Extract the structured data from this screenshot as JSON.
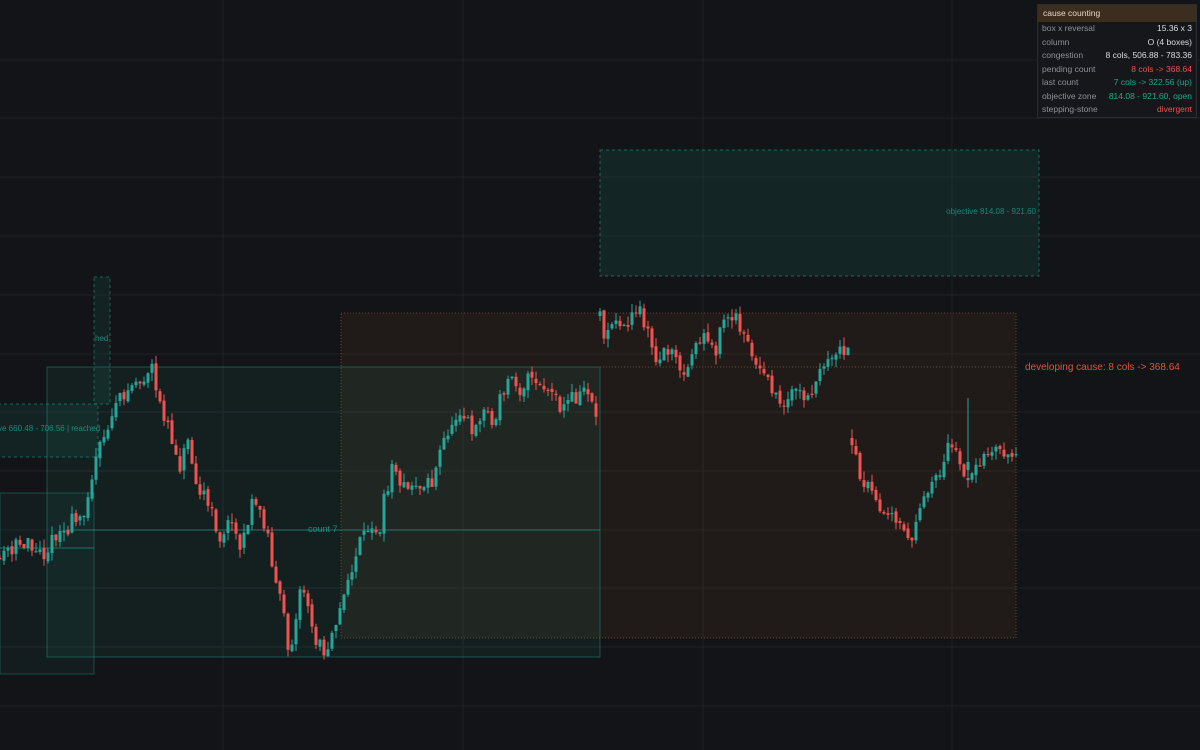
{
  "colors": {
    "background": "#131417",
    "grid": "#1f2126",
    "up": "#26a69a",
    "down": "#ef5350",
    "box_teal": "#1f9c8a",
    "box_orange": "#a9692c",
    "label_red": "#e0533b"
  },
  "panel": {
    "title": "cause counting",
    "rows": [
      {
        "key": "box x reversal",
        "value": "15.36 x 3",
        "tone": "neutral"
      },
      {
        "key": "column",
        "value": "O (4 boxes)",
        "tone": "neutral"
      },
      {
        "key": "congestion",
        "value": "8 cols, 506.88 - 783.36",
        "tone": "neutral"
      },
      {
        "key": "pending count",
        "value": "8 cols -> 368.64",
        "tone": "red"
      },
      {
        "key": "last count",
        "value": "7 cols -> 322.56 (up)",
        "tone": "green"
      },
      {
        "key": "objective zone",
        "value": "814.08 - 921.60, open",
        "tone": "green"
      },
      {
        "key": "stepping-stone",
        "value": "divergent",
        "tone": "red"
      }
    ]
  },
  "annotations": {
    "objective_label": "objective 814.08 - 921.60",
    "count_label": "count 7",
    "developing_label": "developing cause: 8 cols -> 368.64",
    "left_zone_label": "ve 660.48 - 706.56 | reached",
    "left_small_label": "hed"
  },
  "chart_data": {
    "type": "candlestick",
    "ylim": [
      280,
      1040
    ],
    "grid": true,
    "zones": [
      {
        "name": "objective zone",
        "price_low": 814.08,
        "price_high": 921.6
      },
      {
        "name": "congestion",
        "price_low": 506.88,
        "price_high": 783.36
      },
      {
        "name": "developing cause",
        "target": 368.64
      },
      {
        "name": "last count",
        "target": 322.56
      },
      {
        "name": "reached objective",
        "price_low": 660.48,
        "price_high": 706.56
      }
    ],
    "segments": [
      {
        "anchors": [
          [
            0,
            560
          ],
          [
            6,
            548
          ],
          [
            12,
            556
          ],
          [
            18,
            540
          ],
          [
            22,
            548
          ],
          [
            28,
            535
          ],
          [
            34,
            558
          ],
          [
            40,
            545
          ],
          [
            44,
            555
          ],
          [
            50,
            545
          ],
          [
            56,
            535
          ],
          [
            62,
            528
          ],
          [
            66,
            535
          ],
          [
            72,
            520
          ],
          [
            78,
            522
          ],
          [
            84,
            510
          ],
          [
            90,
            485
          ],
          [
            94,
            470
          ],
          [
            98,
            450
          ],
          [
            104,
            440
          ],
          [
            108,
            430
          ],
          [
            112,
            412
          ],
          [
            118,
            402
          ],
          [
            124,
            395
          ],
          [
            130,
            388
          ],
          [
            136,
            380
          ],
          [
            142,
            385
          ],
          [
            148,
            375
          ],
          [
            152,
            368
          ],
          [
            156,
            395
          ],
          [
            160,
            405
          ],
          [
            164,
            415
          ],
          [
            168,
            422
          ],
          [
            172,
            440
          ],
          [
            176,
            455
          ],
          [
            180,
            465
          ],
          [
            184,
            450
          ],
          [
            188,
            440
          ],
          [
            194,
            465
          ],
          [
            198,
            490
          ],
          [
            204,
            495
          ],
          [
            210,
            510
          ],
          [
            214,
            520
          ],
          [
            218,
            535
          ],
          [
            222,
            540
          ],
          [
            226,
            532
          ],
          [
            230,
            520
          ],
          [
            236,
            528
          ],
          [
            240,
            545
          ],
          [
            246,
            530
          ],
          [
            250,
            512
          ],
          [
            254,
            500
          ],
          [
            258,
            510
          ],
          [
            262,
            520
          ],
          [
            266,
            525
          ],
          [
            270,
            548
          ],
          [
            274,
            572
          ],
          [
            278,
            590
          ],
          [
            282,
            608
          ],
          [
            286,
            632
          ],
          [
            290,
            655
          ],
          [
            294,
            625
          ],
          [
            298,
            600
          ],
          [
            302,
            585
          ],
          [
            306,
            598
          ],
          [
            310,
            620
          ],
          [
            314,
            634
          ],
          [
            318,
            648
          ],
          [
            322,
            642
          ],
          [
            326,
            660
          ],
          [
            330,
            632
          ],
          [
            334,
            622
          ],
          [
            338,
            618
          ],
          [
            342,
            600
          ],
          [
            346,
            592
          ],
          [
            350,
            580
          ],
          [
            354,
            560
          ],
          [
            358,
            545
          ],
          [
            362,
            538
          ],
          [
            366,
            535
          ],
          [
            372,
            532
          ],
          [
            376,
            528
          ],
          [
            380,
            530
          ],
          [
            384,
            500
          ],
          [
            388,
            485
          ],
          [
            392,
            470
          ],
          [
            396,
            465
          ],
          [
            400,
            480
          ],
          [
            404,
            488
          ],
          [
            408,
            490
          ],
          [
            412,
            485
          ],
          [
            416,
            482
          ],
          [
            420,
            492
          ],
          [
            424,
            485
          ],
          [
            428,
            480
          ],
          [
            432,
            482
          ],
          [
            436,
            470
          ],
          [
            440,
            455
          ],
          [
            444,
            440
          ],
          [
            448,
            432
          ],
          [
            452,
            425
          ],
          [
            456,
            415
          ],
          [
            460,
            410
          ],
          [
            464,
            412
          ],
          [
            468,
            420
          ],
          [
            472,
            428
          ],
          [
            476,
            424
          ],
          [
            480,
            418
          ],
          [
            484,
            410
          ],
          [
            488,
            412
          ],
          [
            492,
            425
          ],
          [
            496,
            420
          ],
          [
            500,
            400
          ],
          [
            504,
            390
          ],
          [
            508,
            382
          ],
          [
            512,
            372
          ],
          [
            516,
            380
          ],
          [
            520,
            392
          ],
          [
            524,
            385
          ],
          [
            528,
            378
          ],
          [
            532,
            380
          ],
          [
            536,
            385
          ],
          [
            540,
            390
          ],
          [
            544,
            388
          ],
          [
            548,
            392
          ],
          [
            552,
            395
          ],
          [
            556,
            402
          ],
          [
            560,
            410
          ],
          [
            564,
            406
          ],
          [
            568,
            400
          ],
          [
            572,
            396
          ],
          [
            576,
            400
          ],
          [
            580,
            394
          ],
          [
            584,
            388
          ],
          [
            588,
            392
          ],
          [
            592,
            400
          ],
          [
            596,
            415
          ]
        ],
        "seed": 11
      },
      {
        "anchors": [
          [
            600,
            318
          ],
          [
            604,
            345
          ],
          [
            608,
            330
          ],
          [
            612,
            320
          ],
          [
            616,
            325
          ],
          [
            620,
            322
          ],
          [
            624,
            330
          ],
          [
            628,
            332
          ],
          [
            632,
            318
          ],
          [
            636,
            315
          ],
          [
            640,
            305
          ],
          [
            644,
            325
          ],
          [
            648,
            335
          ],
          [
            652,
            350
          ],
          [
            656,
            360
          ],
          [
            660,
            358
          ],
          [
            664,
            350
          ],
          [
            668,
            352
          ],
          [
            672,
            356
          ],
          [
            676,
            362
          ],
          [
            680,
            365
          ],
          [
            684,
            375
          ],
          [
            688,
            368
          ],
          [
            692,
            350
          ],
          [
            696,
            345
          ],
          [
            700,
            340
          ],
          [
            704,
            338
          ],
          [
            708,
            342
          ],
          [
            712,
            345
          ],
          [
            716,
            350
          ],
          [
            720,
            330
          ],
          [
            724,
            322
          ],
          [
            728,
            320
          ],
          [
            732,
            318
          ],
          [
            736,
            315
          ],
          [
            740,
            325
          ],
          [
            744,
            335
          ],
          [
            748,
            345
          ],
          [
            752,
            355
          ],
          [
            756,
            358
          ],
          [
            760,
            362
          ],
          [
            764,
            370
          ],
          [
            768,
            378
          ],
          [
            772,
            390
          ],
          [
            776,
            398
          ],
          [
            780,
            405
          ],
          [
            784,
            400
          ],
          [
            788,
            395
          ],
          [
            792,
            385
          ],
          [
            796,
            388
          ],
          [
            800,
            395
          ],
          [
            804,
            398
          ],
          [
            808,
            395
          ],
          [
            812,
            390
          ],
          [
            816,
            385
          ],
          [
            820,
            375
          ],
          [
            824,
            370
          ],
          [
            828,
            365
          ],
          [
            832,
            362
          ],
          [
            836,
            358
          ],
          [
            840,
            352
          ],
          [
            844,
            350
          ],
          [
            848,
            352
          ]
        ],
        "seed": 23
      },
      {
        "anchors": [
          [
            852,
            440
          ],
          [
            856,
            460
          ],
          [
            860,
            478
          ],
          [
            864,
            490
          ],
          [
            868,
            485
          ],
          [
            872,
            492
          ],
          [
            876,
            500
          ],
          [
            880,
            505
          ],
          [
            884,
            510
          ],
          [
            888,
            508
          ],
          [
            892,
            515
          ],
          [
            896,
            520
          ],
          [
            900,
            528
          ],
          [
            904,
            535
          ],
          [
            908,
            542
          ],
          [
            912,
            538
          ],
          [
            916,
            525
          ],
          [
            920,
            505
          ],
          [
            924,
            492
          ],
          [
            928,
            488
          ],
          [
            932,
            480
          ],
          [
            936,
            478
          ],
          [
            940,
            470
          ],
          [
            944,
            455
          ],
          [
            948,
            448
          ],
          [
            952,
            450
          ],
          [
            956,
            455
          ],
          [
            960,
            465
          ],
          [
            964,
            470
          ],
          [
            968,
            475
          ],
          [
            972,
            478
          ],
          [
            976,
            468
          ],
          [
            980,
            462
          ],
          [
            984,
            458
          ],
          [
            988,
            455
          ],
          [
            992,
            454
          ],
          [
            996,
            452
          ],
          [
            1000,
            455
          ],
          [
            1004,
            458
          ],
          [
            1008,
            460
          ],
          [
            1012,
            455
          ],
          [
            1016,
            456
          ]
        ],
        "seed": 37
      }
    ],
    "spike": {
      "x": 968,
      "high": 398,
      "low": 482
    }
  }
}
